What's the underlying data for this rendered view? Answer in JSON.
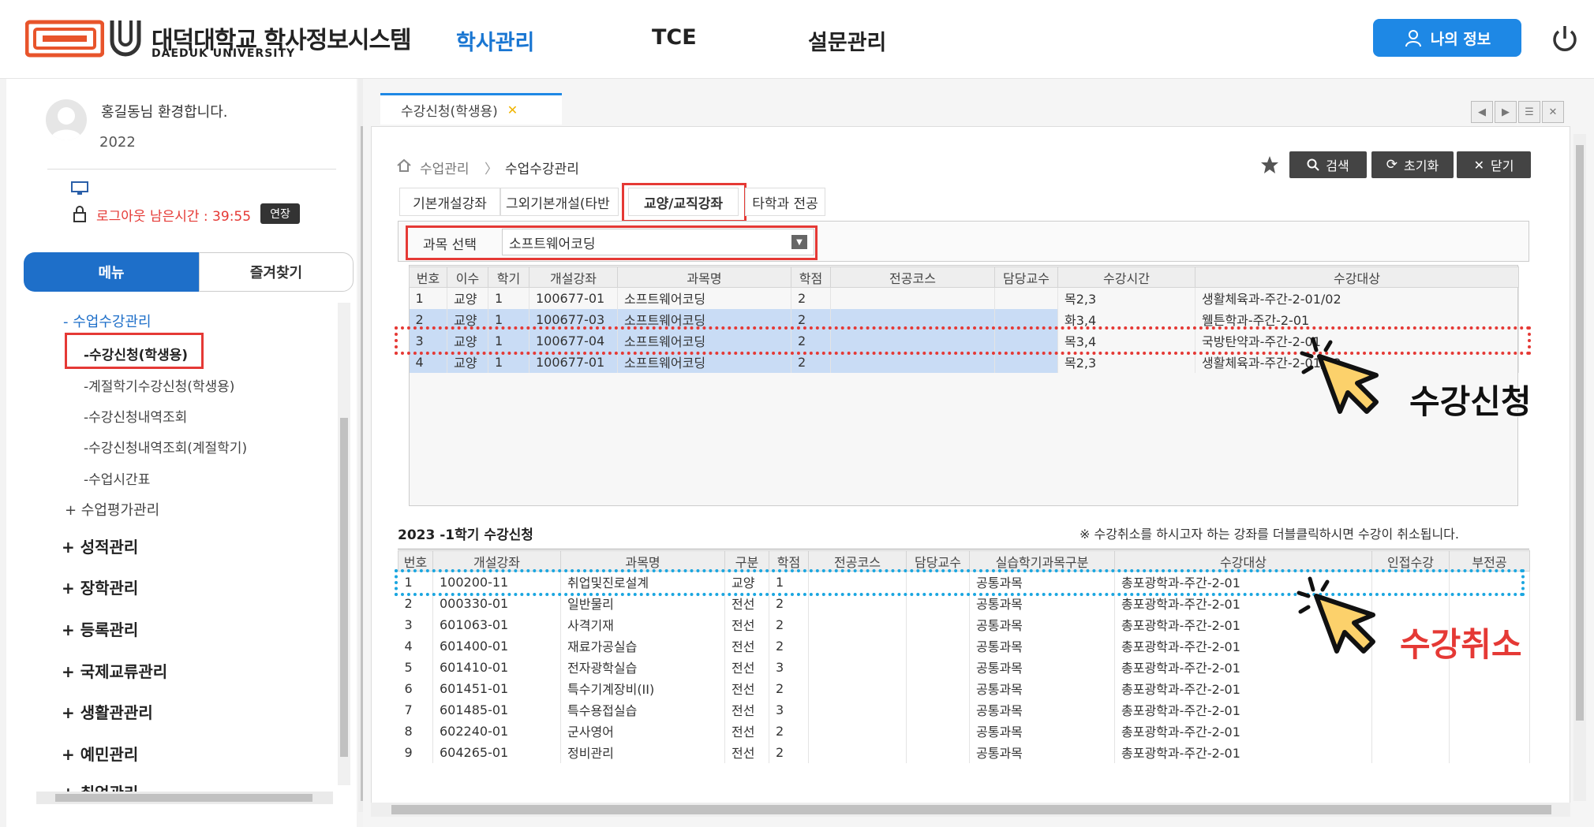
{
  "header": {
    "logo_title": "대덕대학교 학사정보시스템",
    "logo_sub": "DAEDUK UNIVERSITY",
    "nav": [
      "학사관리",
      "TCE",
      "설문관리"
    ],
    "my_info": "나의 정보",
    "accent": "#1e88e5"
  },
  "sidebar": {
    "greeting": "홍길동님 환경합니다.",
    "year": "2022",
    "logout_text": "로그아웃 남은시간 : 39:55",
    "extend": "연장",
    "tabs": [
      "메뉴",
      "즐겨찾기"
    ],
    "group_open": "- 수업수강관리",
    "items": [
      "-수강신청(학생용)",
      "-계절학기수강신청(학생용)",
      "-수강신청내역조회",
      "-수강신청내역조회(계절학기)",
      "-수업시간표"
    ],
    "group_closed": "+ 수업평가관리",
    "top_menus": [
      "+ 성적관리",
      "+ 장학관리",
      "+ 등록관리",
      "+ 국제교류관리",
      "+ 생활관관리",
      "+ 예민관리",
      "+ 취업관리"
    ]
  },
  "main": {
    "doc_tab": "수강신청(학생용)",
    "breadcrumb": [
      "수업관리",
      "수업수강관리"
    ],
    "buttons": {
      "search": "검색",
      "reset": "초기화",
      "close": "닫기"
    },
    "subtabs": [
      "기본개설강좌",
      "그외기본개설(타반",
      "교양/교직강좌",
      "타학과 전공"
    ],
    "filter_label": "과목 선택",
    "filter_value": "소프트웨어코딩",
    "upper_headers": [
      "번호",
      "이수",
      "학기",
      "개설강좌",
      "과목명",
      "학점",
      "전공코스",
      "담당교수",
      "수강시간",
      "수강대상"
    ],
    "upper_rows": [
      [
        "1",
        "교양",
        "1",
        "100677-01",
        "소프트웨어코딩",
        "2",
        "",
        "",
        "목2,3",
        "생활체육과-주간-2-01/02"
      ],
      [
        "2",
        "교양",
        "1",
        "100677-03",
        "소프트웨어코딩",
        "2",
        "",
        "",
        "화3,4",
        "웰튼학과-주간-2-01"
      ],
      [
        "3",
        "교양",
        "1",
        "100677-04",
        "소프트웨어코딩",
        "2",
        "",
        "",
        "목3,4",
        "국방탄약과-주간-2-01"
      ],
      [
        "4",
        "교양",
        "1",
        "100677-01",
        "소프트웨어코딩",
        "2",
        "",
        "",
        "목2,3",
        "생활체육과-주간-2-01/02"
      ]
    ],
    "lower_title": "2023 -1학기 수강신청",
    "lower_note": "※ 수강취소를 하시고자 하는 강좌를 더블클릭하시면 수강이 취소됩니다.",
    "lower_headers": [
      "번호",
      "개설강좌",
      "과목명",
      "구분",
      "학점",
      "전공코스",
      "담당교수",
      "실습학기과목구분",
      "수강대상",
      "인접수강",
      "부전공"
    ],
    "lower_rows": [
      [
        "1",
        "100200-11",
        "취업및진로설계",
        "교양",
        "1",
        "",
        "",
        "공통과목",
        "총포광학과-주간-2-01",
        "",
        ""
      ],
      [
        "2",
        "000330-01",
        "일반물리",
        "전선",
        "2",
        "",
        "",
        "공통과목",
        "총포광학과-주간-2-01",
        "",
        ""
      ],
      [
        "3",
        "601063-01",
        "사격기재",
        "전선",
        "2",
        "",
        "",
        "공통과목",
        "총포광학과-주간-2-01",
        "",
        ""
      ],
      [
        "4",
        "601400-01",
        "재료가공실습",
        "전선",
        "2",
        "",
        "",
        "공통과목",
        "총포광학과-주간-2-01",
        "",
        ""
      ],
      [
        "5",
        "601410-01",
        "전자광학실습",
        "전선",
        "3",
        "",
        "",
        "공통과목",
        "총포광학과-주간-2-01",
        "",
        ""
      ],
      [
        "6",
        "601451-01",
        "특수기계장비(II)",
        "전선",
        "2",
        "",
        "",
        "공통과목",
        "총포광학과-주간-2-01",
        "",
        ""
      ],
      [
        "7",
        "601485-01",
        "특수용접실습",
        "전선",
        "3",
        "",
        "",
        "공통과목",
        "총포광학과-주간-2-01",
        "",
        ""
      ],
      [
        "8",
        "602240-01",
        "군사영어",
        "전선",
        "2",
        "",
        "",
        "공통과목",
        "총포광학과-주간-2-01",
        "",
        ""
      ],
      [
        "9",
        "604265-01",
        "정비관리",
        "전선",
        "2",
        "",
        "",
        "공통과목",
        "총포광학과-주간-2-01",
        "",
        ""
      ]
    ]
  },
  "annotations": {
    "enroll": "수강신청",
    "cancel": "수강취소",
    "enroll_color": "#111111",
    "cancel_color": "#e53935"
  }
}
